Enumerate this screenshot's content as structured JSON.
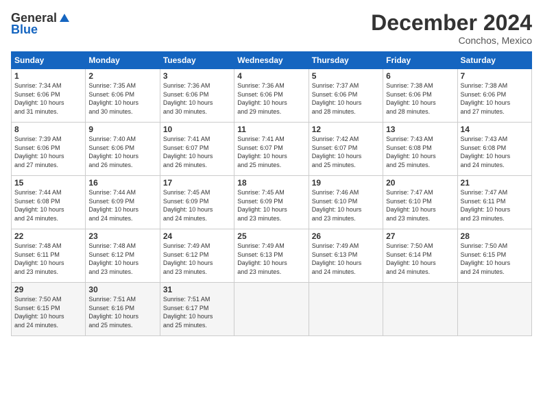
{
  "logo": {
    "line1": "General",
    "line2": "Blue"
  },
  "title": "December 2024",
  "location": "Conchos, Mexico",
  "weekdays": [
    "Sunday",
    "Monday",
    "Tuesday",
    "Wednesday",
    "Thursday",
    "Friday",
    "Saturday"
  ],
  "weeks": [
    [
      {
        "day": "1",
        "info": "Sunrise: 7:34 AM\nSunset: 6:06 PM\nDaylight: 10 hours\nand 31 minutes."
      },
      {
        "day": "2",
        "info": "Sunrise: 7:35 AM\nSunset: 6:06 PM\nDaylight: 10 hours\nand 30 minutes."
      },
      {
        "day": "3",
        "info": "Sunrise: 7:36 AM\nSunset: 6:06 PM\nDaylight: 10 hours\nand 30 minutes."
      },
      {
        "day": "4",
        "info": "Sunrise: 7:36 AM\nSunset: 6:06 PM\nDaylight: 10 hours\nand 29 minutes."
      },
      {
        "day": "5",
        "info": "Sunrise: 7:37 AM\nSunset: 6:06 PM\nDaylight: 10 hours\nand 28 minutes."
      },
      {
        "day": "6",
        "info": "Sunrise: 7:38 AM\nSunset: 6:06 PM\nDaylight: 10 hours\nand 28 minutes."
      },
      {
        "day": "7",
        "info": "Sunrise: 7:38 AM\nSunset: 6:06 PM\nDaylight: 10 hours\nand 27 minutes."
      }
    ],
    [
      {
        "day": "8",
        "info": "Sunrise: 7:39 AM\nSunset: 6:06 PM\nDaylight: 10 hours\nand 27 minutes."
      },
      {
        "day": "9",
        "info": "Sunrise: 7:40 AM\nSunset: 6:06 PM\nDaylight: 10 hours\nand 26 minutes."
      },
      {
        "day": "10",
        "info": "Sunrise: 7:41 AM\nSunset: 6:07 PM\nDaylight: 10 hours\nand 26 minutes."
      },
      {
        "day": "11",
        "info": "Sunrise: 7:41 AM\nSunset: 6:07 PM\nDaylight: 10 hours\nand 25 minutes."
      },
      {
        "day": "12",
        "info": "Sunrise: 7:42 AM\nSunset: 6:07 PM\nDaylight: 10 hours\nand 25 minutes."
      },
      {
        "day": "13",
        "info": "Sunrise: 7:43 AM\nSunset: 6:08 PM\nDaylight: 10 hours\nand 25 minutes."
      },
      {
        "day": "14",
        "info": "Sunrise: 7:43 AM\nSunset: 6:08 PM\nDaylight: 10 hours\nand 24 minutes."
      }
    ],
    [
      {
        "day": "15",
        "info": "Sunrise: 7:44 AM\nSunset: 6:08 PM\nDaylight: 10 hours\nand 24 minutes."
      },
      {
        "day": "16",
        "info": "Sunrise: 7:44 AM\nSunset: 6:09 PM\nDaylight: 10 hours\nand 24 minutes."
      },
      {
        "day": "17",
        "info": "Sunrise: 7:45 AM\nSunset: 6:09 PM\nDaylight: 10 hours\nand 24 minutes."
      },
      {
        "day": "18",
        "info": "Sunrise: 7:45 AM\nSunset: 6:09 PM\nDaylight: 10 hours\nand 23 minutes."
      },
      {
        "day": "19",
        "info": "Sunrise: 7:46 AM\nSunset: 6:10 PM\nDaylight: 10 hours\nand 23 minutes."
      },
      {
        "day": "20",
        "info": "Sunrise: 7:47 AM\nSunset: 6:10 PM\nDaylight: 10 hours\nand 23 minutes."
      },
      {
        "day": "21",
        "info": "Sunrise: 7:47 AM\nSunset: 6:11 PM\nDaylight: 10 hours\nand 23 minutes."
      }
    ],
    [
      {
        "day": "22",
        "info": "Sunrise: 7:48 AM\nSunset: 6:11 PM\nDaylight: 10 hours\nand 23 minutes."
      },
      {
        "day": "23",
        "info": "Sunrise: 7:48 AM\nSunset: 6:12 PM\nDaylight: 10 hours\nand 23 minutes."
      },
      {
        "day": "24",
        "info": "Sunrise: 7:49 AM\nSunset: 6:12 PM\nDaylight: 10 hours\nand 23 minutes."
      },
      {
        "day": "25",
        "info": "Sunrise: 7:49 AM\nSunset: 6:13 PM\nDaylight: 10 hours\nand 23 minutes."
      },
      {
        "day": "26",
        "info": "Sunrise: 7:49 AM\nSunset: 6:13 PM\nDaylight: 10 hours\nand 24 minutes."
      },
      {
        "day": "27",
        "info": "Sunrise: 7:50 AM\nSunset: 6:14 PM\nDaylight: 10 hours\nand 24 minutes."
      },
      {
        "day": "28",
        "info": "Sunrise: 7:50 AM\nSunset: 6:15 PM\nDaylight: 10 hours\nand 24 minutes."
      }
    ],
    [
      {
        "day": "29",
        "info": "Sunrise: 7:50 AM\nSunset: 6:15 PM\nDaylight: 10 hours\nand 24 minutes."
      },
      {
        "day": "30",
        "info": "Sunrise: 7:51 AM\nSunset: 6:16 PM\nDaylight: 10 hours\nand 25 minutes."
      },
      {
        "day": "31",
        "info": "Sunrise: 7:51 AM\nSunset: 6:17 PM\nDaylight: 10 hours\nand 25 minutes."
      },
      null,
      null,
      null,
      null
    ]
  ]
}
